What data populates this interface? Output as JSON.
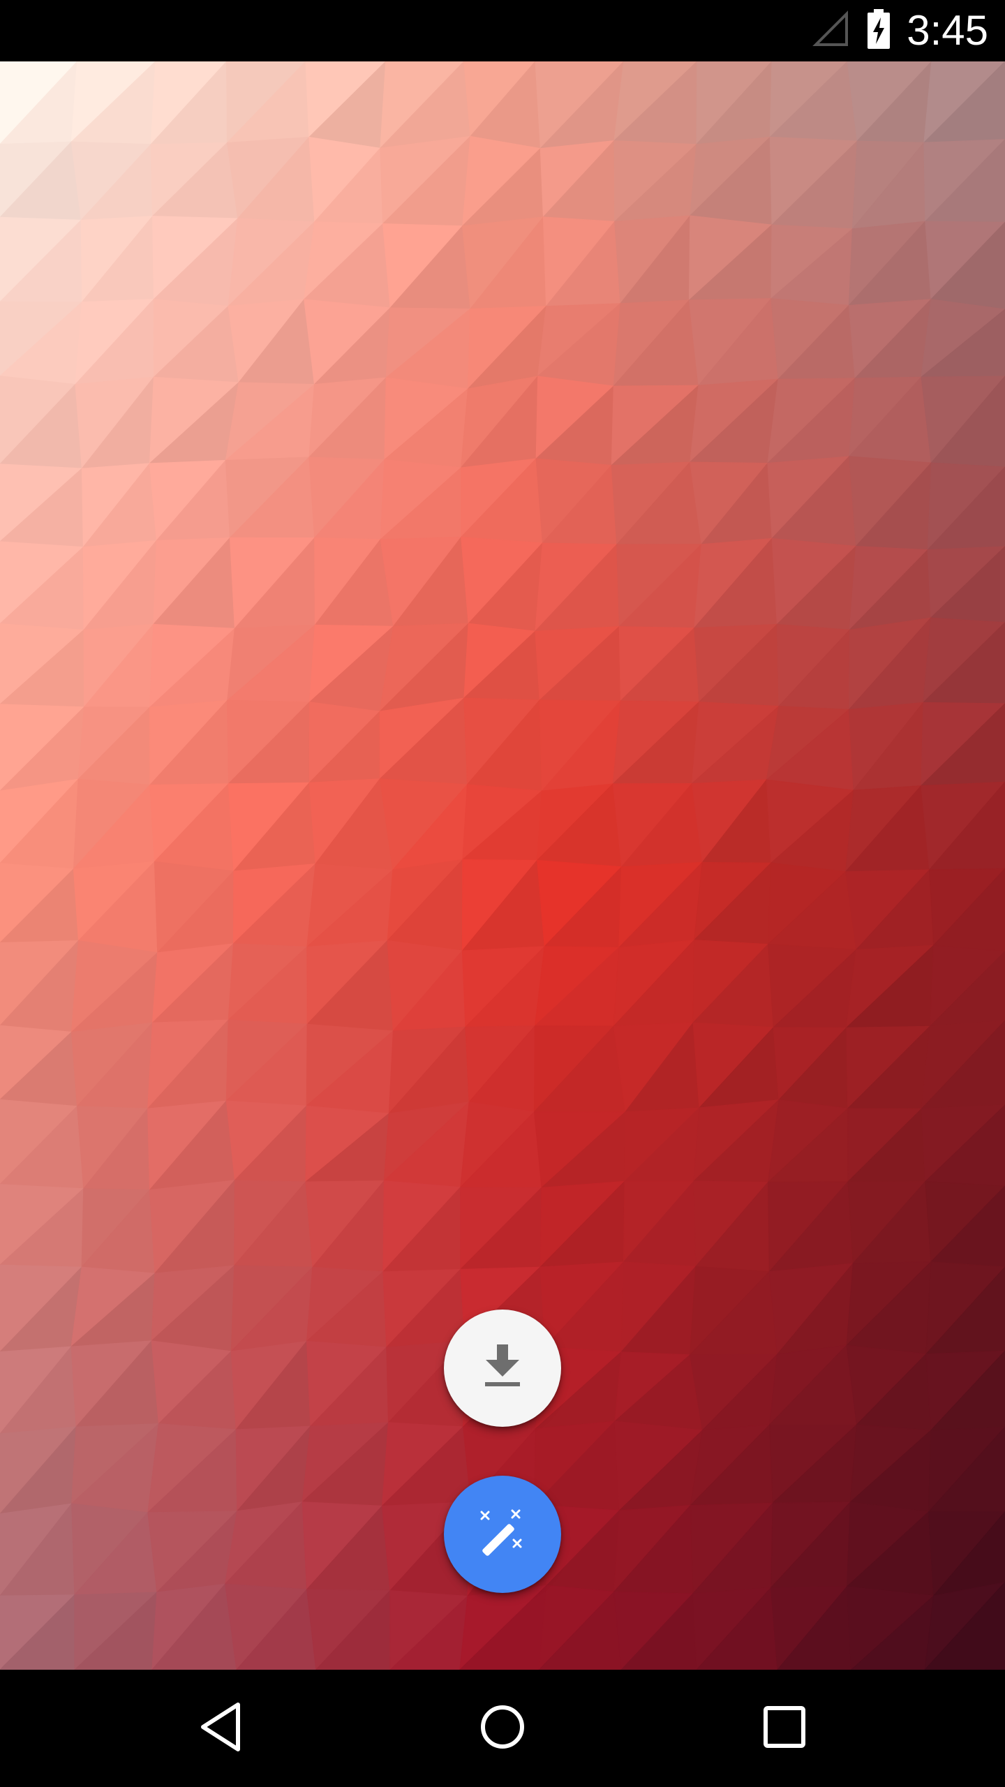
{
  "status_bar": {
    "time": "3:45",
    "icons": [
      "signal-icon",
      "battery-charging-icon"
    ]
  },
  "wallpaper": {
    "style": "low-poly triangle mosaic",
    "colors": {
      "top_left": "#fffaf2",
      "center": "#e8342a",
      "right_top": "#a88a8c",
      "bottom_right": "#3a0a1a"
    }
  },
  "fabs": {
    "download": {
      "icon": "download-icon",
      "background": "#f5f5f5"
    },
    "magic": {
      "icon": "magic-wand-icon",
      "background": "#4285f4"
    }
  },
  "nav_bar": {
    "buttons": [
      "back-icon",
      "home-icon",
      "recents-icon"
    ]
  }
}
